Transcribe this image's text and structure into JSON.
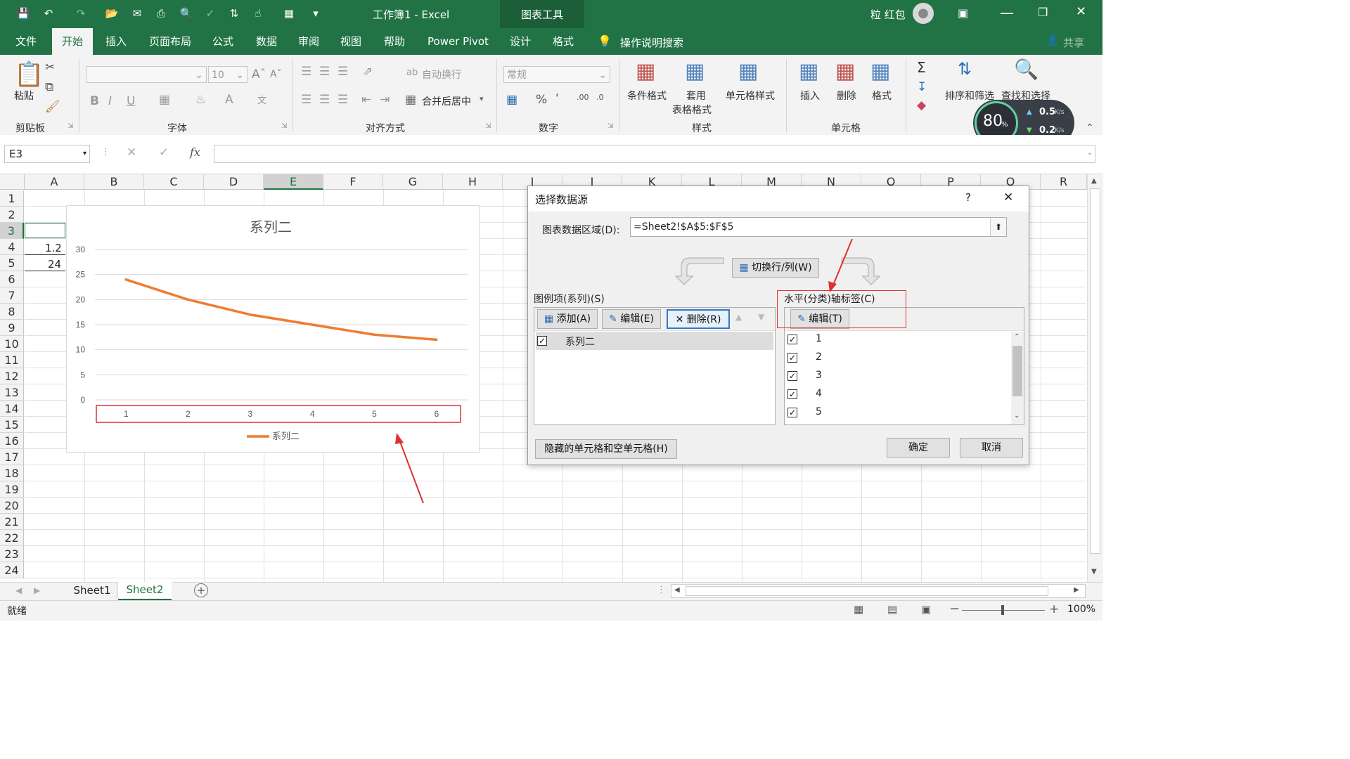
{
  "app": {
    "title": "工作簿1  -  Excel",
    "context_tab_group": "图表工具",
    "user_name": "粒 红包",
    "share_label": "共享"
  },
  "tabs": [
    "文件",
    "开始",
    "插入",
    "页面布局",
    "公式",
    "数据",
    "审阅",
    "视图",
    "帮助",
    "Power Pivot",
    "设计",
    "格式"
  ],
  "tell_me": "操作说明搜索",
  "ribbon": {
    "clipboard": {
      "paste": "粘贴",
      "group": "剪贴板"
    },
    "font": {
      "size": "10",
      "group": "字体"
    },
    "alignment": {
      "wrap": "自动换行",
      "merge": "合并后居中",
      "group": "对齐方式"
    },
    "number": {
      "format": "常规",
      "group": "数字"
    },
    "styles": {
      "conditional": "条件格式",
      "table_fmt_1": "套用",
      "table_fmt_2": "表格格式",
      "cell_styles": "单元格样式",
      "group": "样式"
    },
    "cells": {
      "insert": "插入",
      "delete": "删除",
      "format": "格式",
      "group": "单元格"
    },
    "editing": {
      "sort_filter": "排序和筛选",
      "find_select": "查找和选择"
    }
  },
  "netmon": {
    "percent": "80",
    "pct_sign": "%",
    "up": "0.5",
    "down": "0.2",
    "unit": "K/s"
  },
  "formula_bar": {
    "name_box": "E3",
    "formula": ""
  },
  "grid": {
    "columns": [
      "A",
      "B",
      "C",
      "D",
      "E",
      "F",
      "G",
      "H",
      "I",
      "J",
      "K",
      "L",
      "M",
      "N",
      "O",
      "P",
      "Q",
      "R"
    ],
    "rows": [
      "1",
      "2",
      "3",
      "4",
      "5",
      "6",
      "7",
      "8",
      "9",
      "10",
      "11",
      "12",
      "13",
      "14",
      "15",
      "16",
      "17",
      "18",
      "19",
      "20",
      "21",
      "22",
      "23",
      "24"
    ],
    "cell_A4": "1.2",
    "cell_A5": "24"
  },
  "chart_data": {
    "type": "line",
    "title": "系列二",
    "categories": [
      "1",
      "2",
      "3",
      "4",
      "5",
      "6"
    ],
    "series": [
      {
        "name": "系列二",
        "values": [
          24,
          20,
          17,
          15,
          13,
          12
        ],
        "color": "#ED7D31"
      }
    ],
    "ylim": [
      0,
      30
    ],
    "yticks": [
      "30",
      "25",
      "20",
      "15",
      "10",
      "5",
      "0"
    ],
    "grid": true,
    "legend": "bottom"
  },
  "dialog": {
    "title": "选择数据源",
    "help": "?",
    "close": "✕",
    "range_label": "图表数据区域(D):",
    "range_value": "=Sheet2!$A$5:$F$5",
    "switch_button": "切换行/列(W)",
    "legend_header": "图例项(系列)(S)",
    "add": "添加(A)",
    "edit": "编辑(E)",
    "remove": "删除(R)",
    "series_items": [
      "系列二"
    ],
    "axis_header": "水平(分类)轴标签(C)",
    "axis_edit": "编辑(T)",
    "axis_items": [
      "1",
      "2",
      "3",
      "4",
      "5"
    ],
    "hidden_cells": "隐藏的单元格和空单元格(H)",
    "ok": "确定",
    "cancel": "取消"
  },
  "sheets": [
    "Sheet1",
    "Sheet2"
  ],
  "active_sheet": "Sheet2",
  "status": {
    "ready": "就绪",
    "zoom": "100%"
  },
  "colors": {
    "excel_green": "#217346",
    "annotation_red": "#E03030",
    "series_orange": "#ED7D31"
  }
}
